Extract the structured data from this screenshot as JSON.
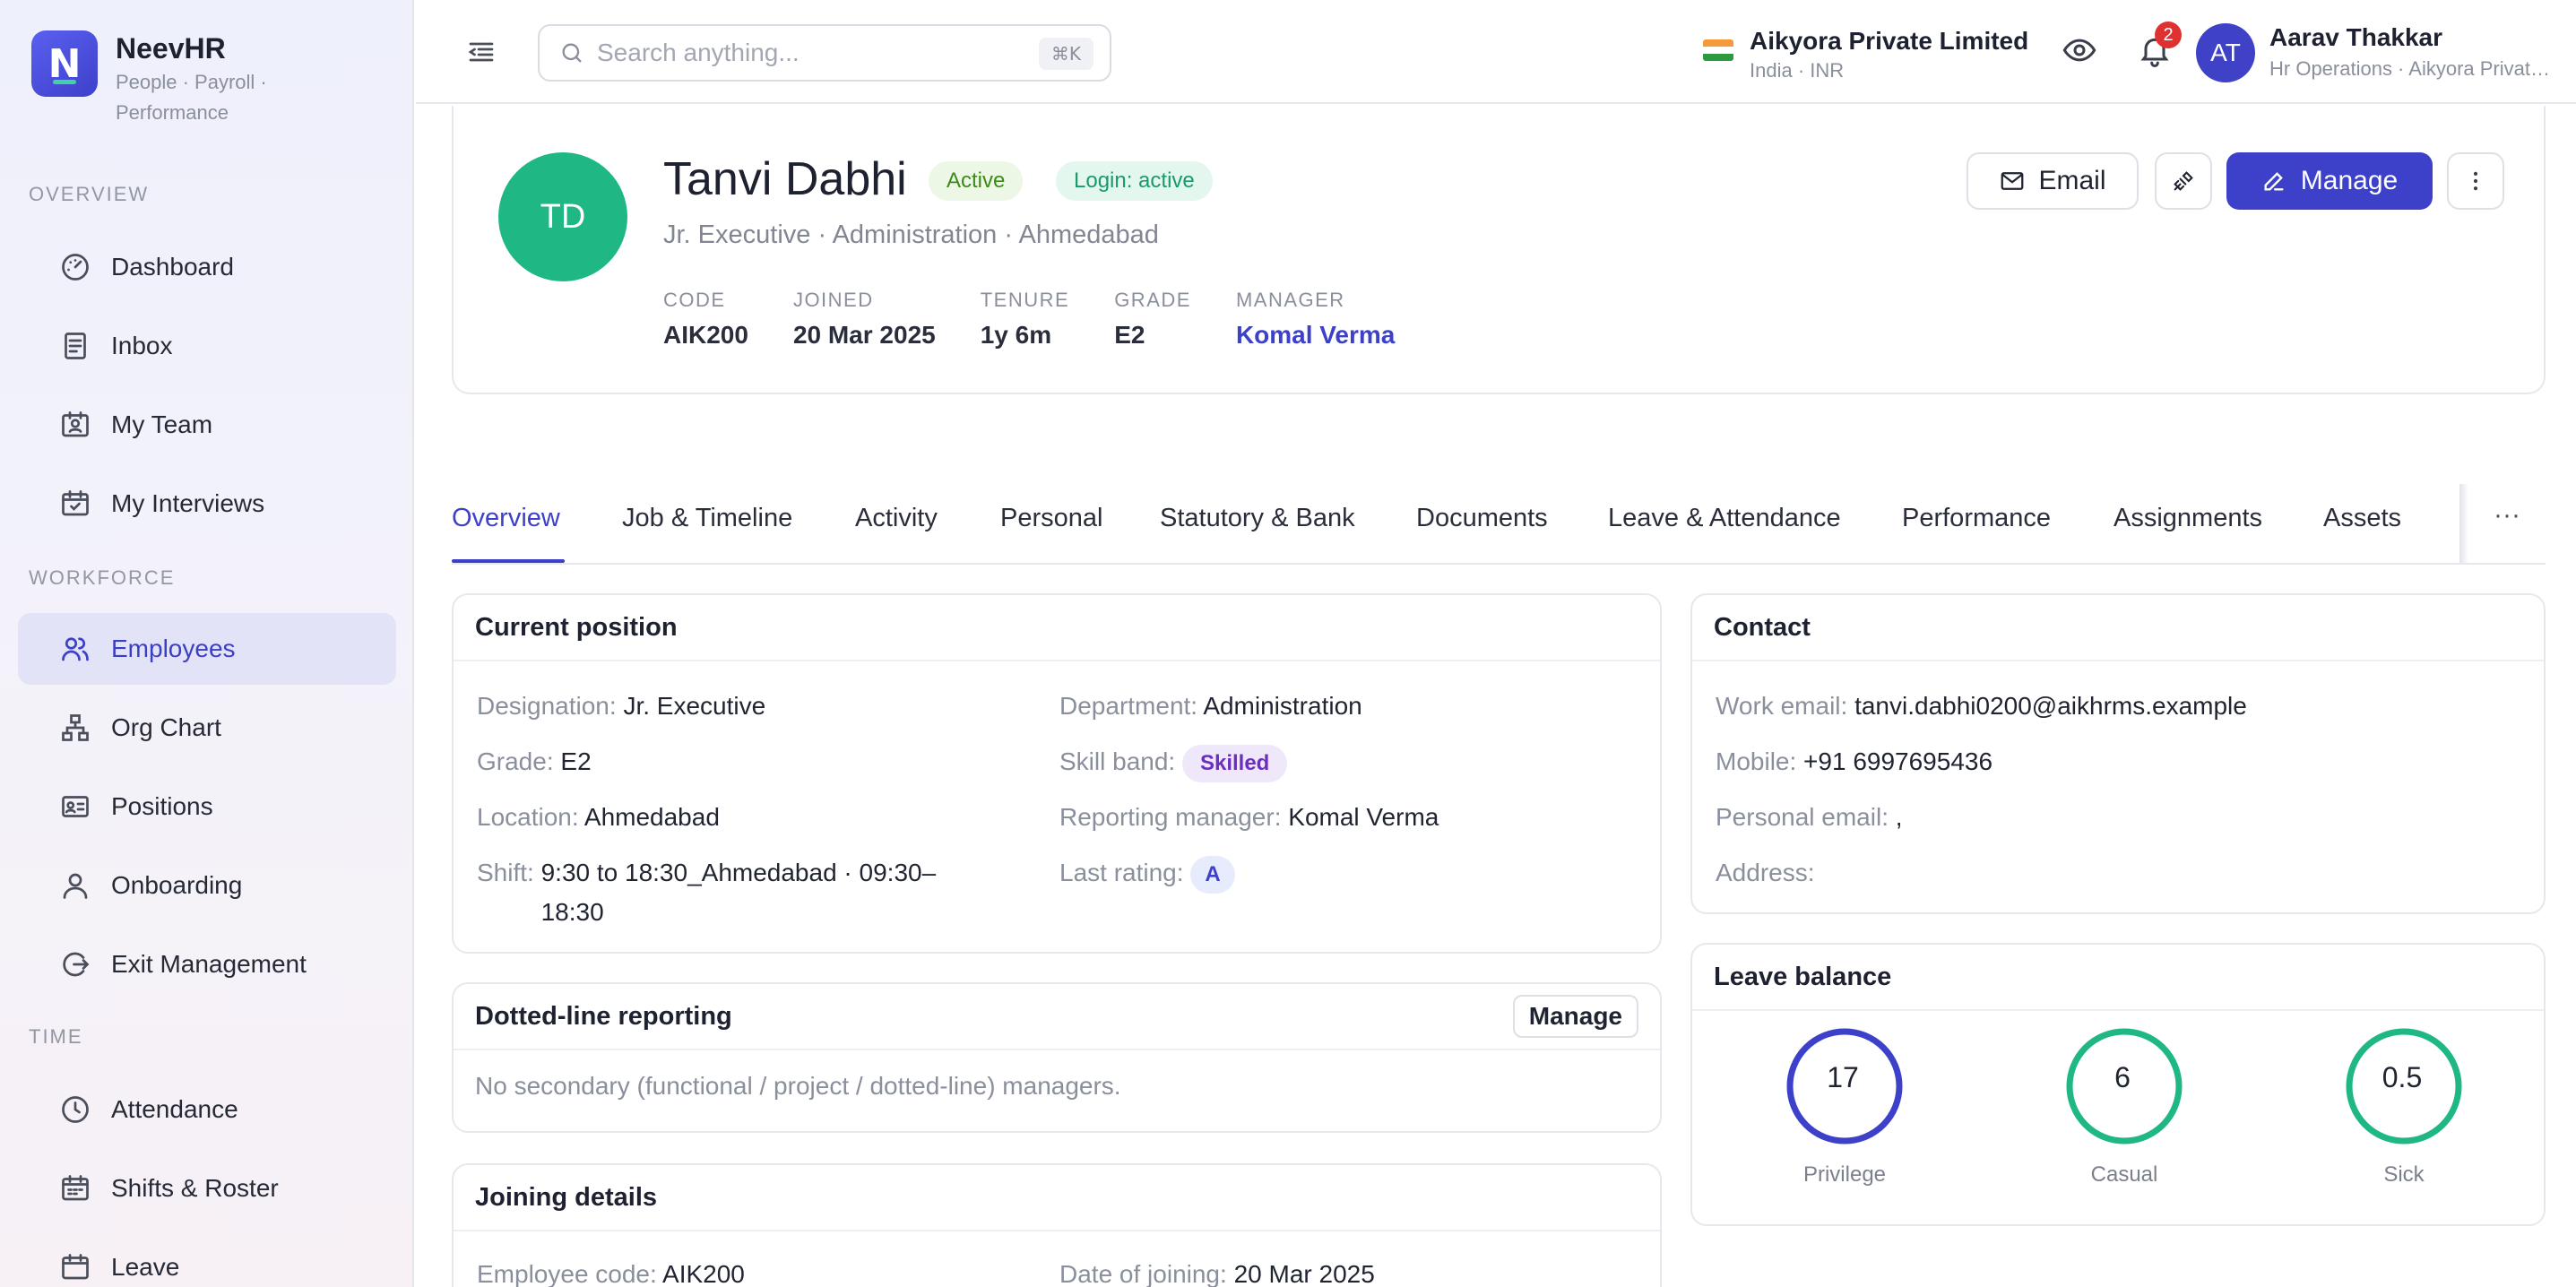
{
  "brand": {
    "name": "NeevHR",
    "sub": "People · Payroll · Performance"
  },
  "sidebar": {
    "sections": {
      "overview": "OVERVIEW",
      "workforce": "WORKFORCE",
      "time": "TIME"
    },
    "items": [
      {
        "label": "Dashboard",
        "icon": "gauge-icon"
      },
      {
        "label": "Inbox",
        "icon": "inbox-icon"
      },
      {
        "label": "My Team",
        "icon": "team-icon"
      },
      {
        "label": "My Interviews",
        "icon": "calendar-check-icon"
      },
      {
        "label": "Employees",
        "icon": "users-icon"
      },
      {
        "label": "Org Chart",
        "icon": "org-chart-icon"
      },
      {
        "label": "Positions",
        "icon": "id-card-icon"
      },
      {
        "label": "Onboarding",
        "icon": "user-icon"
      },
      {
        "label": "Exit Management",
        "icon": "exit-icon"
      },
      {
        "label": "Attendance",
        "icon": "clock-icon"
      },
      {
        "label": "Shifts & Roster",
        "icon": "calendar-grid-icon"
      },
      {
        "label": "Leave",
        "icon": "calendar-icon"
      }
    ]
  },
  "topbar": {
    "search_placeholder": "Search anything...",
    "search_shortcut": "⌘K",
    "org_name": "Aikyora Private Limited",
    "org_sub": "India · INR",
    "notification_count": "2",
    "user_initials": "AT",
    "user_name": "Aarav Thakkar",
    "user_role": "Hr Operations · Aikyora Private Limited"
  },
  "employee": {
    "initials": "TD",
    "name": "Tanvi Dabhi",
    "status": "Active",
    "login_status": "Login: active",
    "meta": "Jr. Executive · Administration · Ahmedabad",
    "stats": [
      {
        "label": "CODE",
        "value": "AIK200"
      },
      {
        "label": "JOINED",
        "value": "20 Mar 2025"
      },
      {
        "label": "TENURE",
        "value": "1y 6m"
      },
      {
        "label": "GRADE",
        "value": "E2"
      },
      {
        "label": "MANAGER",
        "value": "Komal Verma"
      }
    ],
    "actions": {
      "email": "Email",
      "manage": "Manage"
    }
  },
  "tabs": [
    "Overview",
    "Job & Timeline",
    "Activity",
    "Personal",
    "Statutory & Bank",
    "Documents",
    "Leave & Attendance",
    "Performance",
    "Assignments",
    "Assets"
  ],
  "tab_overflow": "···",
  "current_position": {
    "title": "Current position",
    "designation": {
      "k": "Designation",
      "v": "Jr. Executive"
    },
    "department": {
      "k": "Department",
      "v": "Administration"
    },
    "grade": {
      "k": "Grade",
      "v": "E2"
    },
    "skill_band": {
      "k": "Skill band",
      "v": "Skilled"
    },
    "location": {
      "k": "Location",
      "v": "Ahmedabad"
    },
    "reporting_manager": {
      "k": "Reporting manager",
      "v": "Komal Verma"
    },
    "shift": {
      "k": "Shift",
      "v1": "9:30 to 18:30_Ahmedabad · 09:30–",
      "v2": "18:30"
    },
    "last_rating": {
      "k": "Last rating",
      "v": "A"
    }
  },
  "dotted_line": {
    "title": "Dotted-line reporting",
    "button": "Manage",
    "empty": "No secondary (functional / project / dotted-line) managers."
  },
  "joining": {
    "title": "Joining details",
    "employee_code": {
      "k": "Employee code",
      "v": "AIK200"
    },
    "date_of_joining": {
      "k": "Date of joining",
      "v": "20 Mar 2025"
    }
  },
  "contact": {
    "title": "Contact",
    "work_email": {
      "k": "Work email",
      "v": "tanvi.dabhi0200@aikhrms.example"
    },
    "mobile": {
      "k": "Mobile",
      "v": "+91 6997695436"
    },
    "personal_email": {
      "k": "Personal email",
      "v": ","
    },
    "address": {
      "k": "Address",
      "v": ""
    }
  },
  "leave_balance": {
    "title": "Leave balance",
    "items": [
      {
        "label": "Privilege",
        "value": "17",
        "color": "#3d40c9"
      },
      {
        "label": "Casual",
        "value": "6",
        "color": "#1fb885"
      },
      {
        "label": "Sick",
        "value": "0.5",
        "color": "#1fb885"
      }
    ]
  },
  "colors": {
    "accent": "#3d40c9",
    "success": "#1fb885"
  }
}
